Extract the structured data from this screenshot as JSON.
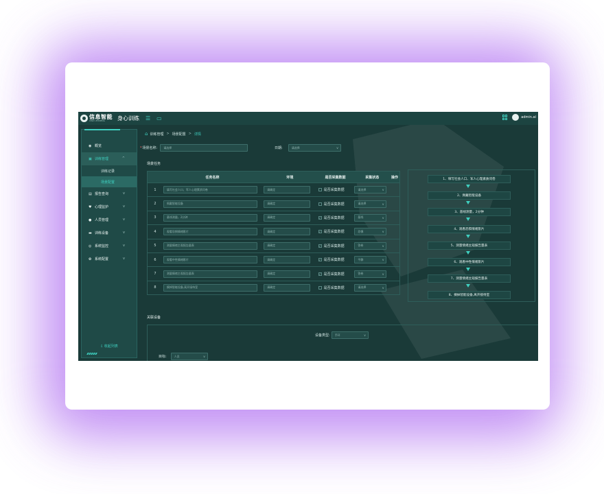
{
  "header": {
    "brand": "信息智能",
    "brand_sub": "XINXI ZHINENG",
    "app_title": "身心训练",
    "user_name": "admin.ai"
  },
  "sidebar": {
    "items": [
      {
        "label": "概览",
        "icon": "overview-icon"
      },
      {
        "label": "训练管理",
        "icon": "training-icon",
        "active": true
      },
      {
        "label": "报告查询",
        "icon": "report-icon"
      },
      {
        "label": "心理监护",
        "icon": "heart-icon"
      },
      {
        "label": "人员管理",
        "icon": "person-icon"
      },
      {
        "label": "训练设备",
        "icon": "device-icon"
      },
      {
        "label": "系统监控",
        "icon": "monitor-icon"
      },
      {
        "label": "系统配置",
        "icon": "gear-icon"
      }
    ],
    "sub_items": [
      {
        "label": "训练记录"
      },
      {
        "label": "场景配置",
        "active": true
      }
    ],
    "collapse_label": "收起列表"
  },
  "breadcrumb": {
    "items": [
      "训练管理",
      "场景配置",
      "详情"
    ],
    "sep": ">"
  },
  "form": {
    "scene_name_label": "场景名称:",
    "scene_name_placeholder": "请选择",
    "date_label": "日期:",
    "date_placeholder": "请选择"
  },
  "tasks": {
    "section_title": "场景任务",
    "columns": [
      "任务名称",
      "环境",
      "是否采集数据",
      "采集状态",
      "操作"
    ],
    "collect_label": "是否采集数据",
    "rows": [
      {
        "no": "1",
        "name": "填写社会人口、军人心理素质问卷",
        "env": "请确定",
        "checked": false,
        "status": "请选择"
      },
      {
        "no": "2",
        "name": "佩戴智能设备",
        "env": "请确定",
        "checked": false,
        "status": "请选择"
      },
      {
        "no": "3",
        "name": "基线测量，2分钟",
        "env": "请确定",
        "checked": true,
        "status": "基线"
      },
      {
        "no": "4",
        "name": "观看恐惧情绪影片",
        "env": "请确定",
        "checked": true,
        "status": "恐惧"
      },
      {
        "no": "5",
        "name": "测量情绪主观报告量表",
        "env": "请确定",
        "checked": true,
        "status": "答卷"
      },
      {
        "no": "6",
        "name": "观看中性情绪影片",
        "env": "请确定",
        "checked": true,
        "status": "平静"
      },
      {
        "no": "7",
        "name": "测量情绪主观报告量表",
        "env": "请确定",
        "checked": true,
        "status": "答卷"
      },
      {
        "no": "8",
        "name": "摘掉智能设备,离开接待室",
        "env": "请确定",
        "checked": false,
        "status": "请选择"
      }
    ]
  },
  "flow": {
    "steps": [
      "1、填写社会人口、军人心理素质问卷",
      "2、佩戴智能设备",
      "3、基线测量，2分钟",
      "4、观看恐惧情绪影片",
      "5、测量情绪主观报告量表",
      "6、观看中性情绪影片",
      "7、测量情绪主观报告量表",
      "8、摘掉智能设备,离开接待室"
    ]
  },
  "devices": {
    "section_title": "关联设备",
    "type_label": "设备类型:",
    "type_value": "手环",
    "target_label": "目标:",
    "target_value": "人员"
  },
  "colors": {
    "accent": "#3fd0c0",
    "app_bg": "#1a3a38",
    "glow": "#b77cf2"
  }
}
